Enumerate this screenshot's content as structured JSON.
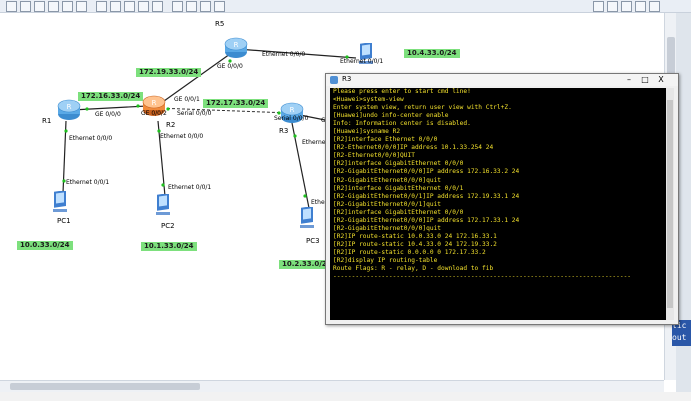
{
  "topology": {
    "devices": {
      "r5": "R5",
      "r1": "R1",
      "r2": "R2",
      "r3": "R3",
      "pc1": "PC1",
      "pc2": "PC2",
      "pc3": "PC3"
    },
    "interfaces": {
      "r5_ge": "GE 0/0/0",
      "r5_eth": "Ethernet 0/0/0",
      "pc_r5_eth": "Ethernet 0/0/1",
      "r2_ge1": "GE 0/0/1",
      "r2_ge2": "GE 0/0/2",
      "r2_serial": "Serial 0/0/0",
      "r1_ge": "GE 0/0/0",
      "r1_eth": "Ethernet 0/0/0",
      "pc1_eth": "Ethernet 0/0/1",
      "r2_eth": "Ethernet 0/0/0",
      "pc2_eth": "Ethernet 0/0/1",
      "r3_serial": "Serial 0/0/0",
      "r3_eth": "Ethernet",
      "pc3_eth": "Ether",
      "r3_g": "G"
    },
    "networks": {
      "n1": "172.19.33.0/24",
      "n2": "10.4.33.0/24",
      "n3": "172.16.33.0/24",
      "n4": "172.17.33.0/24",
      "n5": "10.0.33.0/24",
      "n6": "10.1.33.0/24",
      "n7": "10.2.33.0/2"
    }
  },
  "terminal": {
    "title": "R3",
    "controls": {
      "minimize": "–",
      "maximize": "□",
      "close": "X"
    },
    "lines": [
      "Please press enter to start cmd line!",
      "",
      "<Huawei>system-view",
      "Enter system view, return user view with Ctrl+Z.",
      "[Huawei]undo info-center enable",
      "Info: Information center is disabled.",
      "[Huawei]sysname R2",
      "[R2]interface Ethernet 0/0/0",
      "[R2-Ethernet0/0/0]IP address 10.1.33.254 24",
      "[R2-Ethernet0/0/0]QUIT",
      "[R2]interface GigabitEthernet 0/0/0",
      "[R2-GigabitEthernet0/0/0]IP address 172.16.33.2 24",
      "[R2-GigabitEthernet0/0/0]quit",
      "[R2]interface GigabitEthernet 0/0/1",
      "[R2-GigabitEthernet0/0/1]IP address 172.19.33.1 24",
      "[R2-GigabitEthernet0/0/1]quit",
      "[R2]interface GigabitEthernet 0/0/0",
      "[R2-GigabitEthernet0/0/0]IP address 172.17.33.1 24",
      "[R2-GigabitEthernet0/0/0]quit",
      "[R2]IP route-static 10.0.33.0 24 172.16.33.1",
      "[R2]IP route-static 10.4.33.0 24 172.19.33.2",
      "[R2]IP route-static 0.0.0.0 0 172.17.33.2",
      "[R2]display IP routing-table",
      "Route Flags: R - relay, D - download to fib",
      "--------------------------------------------------------------------------------"
    ]
  },
  "overflow": {
    "line1": "lic",
    "line2": "out"
  },
  "colors": {
    "network_label_bg": "#7de07d",
    "terminal_text": "#f2e02c",
    "router_body": "#5aa9e6",
    "router_core": "#f08a3c"
  }
}
